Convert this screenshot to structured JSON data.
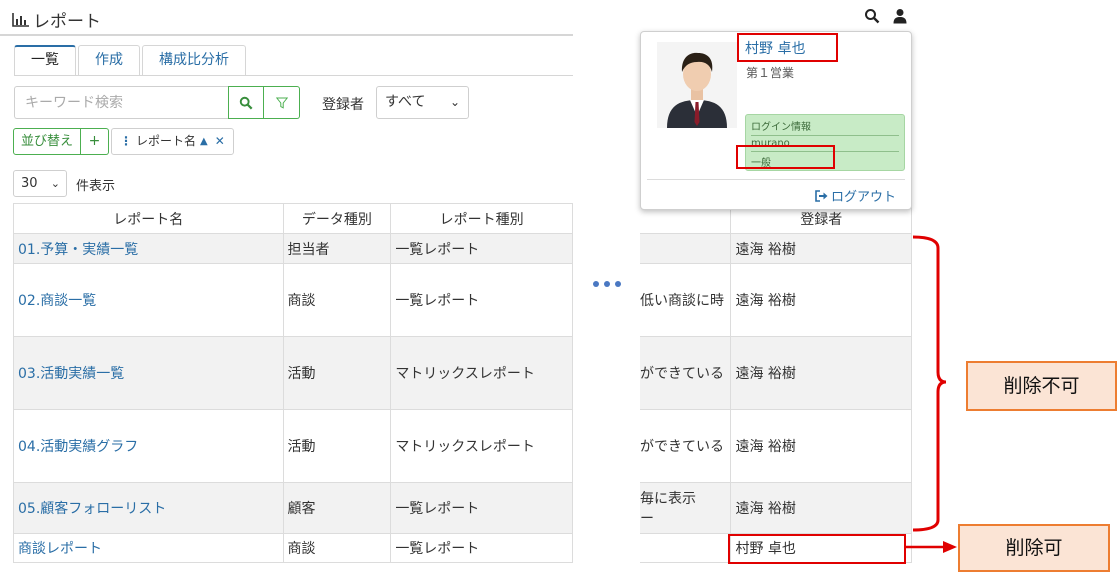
{
  "app": {
    "title": "レポート"
  },
  "header_icons": [
    "search-icon",
    "user-icon"
  ],
  "tabs": [
    {
      "label": "一覧",
      "active": true
    },
    {
      "label": "作成",
      "active": false
    },
    {
      "label": "構成比分析",
      "active": false
    }
  ],
  "search": {
    "placeholder": "キーワード検索",
    "value": ""
  },
  "registrant_filter": {
    "label": "登録者",
    "selected": "すべて"
  },
  "sort": {
    "button_label": "並び替え",
    "add_label": "+",
    "chip_label": "レポート名",
    "chip_direction": "▲"
  },
  "page_size": {
    "value": "30",
    "suffix": "件表示"
  },
  "table": {
    "headers": [
      "レポート名",
      "データ種別",
      "レポート種別"
    ],
    "rows": [
      {
        "name": "01.予算・実績一覧",
        "data_type": "担当者",
        "report_type": "一覧レポート"
      },
      {
        "name": "02.商談一覧",
        "data_type": "商談",
        "report_type": "一覧レポート"
      },
      {
        "name": "03.活動実績一覧",
        "data_type": "活動",
        "report_type": "マトリックスレポート"
      },
      {
        "name": "04.活動実績グラフ",
        "data_type": "活動",
        "report_type": "マトリックスレポート"
      },
      {
        "name": "05.顧客フォローリスト",
        "data_type": "顧客",
        "report_type": "一覧レポート"
      },
      {
        "name": "商談レポート",
        "data_type": "商談",
        "report_type": "一覧レポート"
      }
    ]
  },
  "right_table": {
    "header": "登録者",
    "rows": [
      {
        "desc": "",
        "registrant": "遠海 裕樹"
      },
      {
        "desc": "低い商談に時",
        "registrant": "遠海 裕樹"
      },
      {
        "desc": "ができている",
        "registrant": "遠海 裕樹"
      },
      {
        "desc": "ができている",
        "registrant": "遠海 裕樹"
      },
      {
        "desc": "毎に表示",
        "desc2": "ー",
        "registrant": "遠海 裕樹"
      },
      {
        "desc": "",
        "registrant": "村野 卓也"
      }
    ]
  },
  "user_popup": {
    "name": "村野 卓也",
    "department": "第１営業",
    "login_info_label": "ログイン情報",
    "login_id": "murano",
    "role": "一般",
    "logout_label": "ログアウト"
  },
  "annotations": {
    "not_deletable": "削除不可",
    "deletable": "削除可",
    "highlight_color": "#e00000",
    "callout_color": "#ed7d31"
  }
}
